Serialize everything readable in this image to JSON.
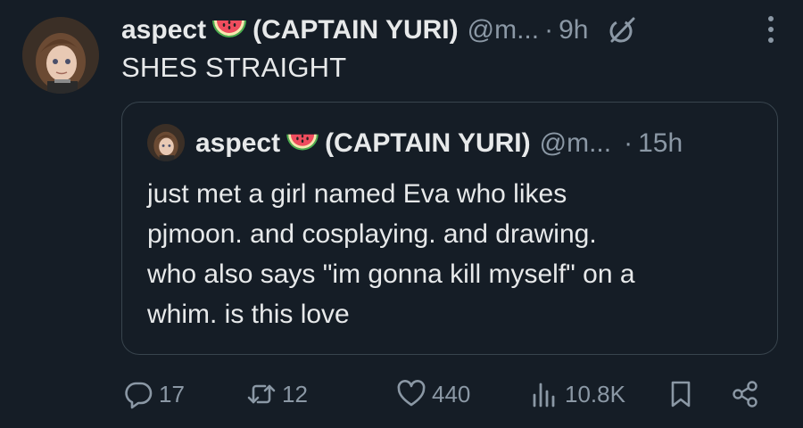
{
  "tweet": {
    "author_name": "aspect",
    "author_name_suffix": "(CAPTAIN YURI)",
    "handle": "@m...",
    "separator": "·",
    "time": "9h",
    "text": "SHES STRAIGHT"
  },
  "quote": {
    "author_name": "aspect",
    "author_name_suffix": "(CAPTAIN YURI)",
    "handle": "@m...",
    "separator": "·",
    "time": "15h",
    "lines": [
      "just met a girl named Eva who likes",
      "pjmoon. and cosplaying. and drawing.",
      "who also says \"im gonna kill myself\" on a",
      "whim. is this love"
    ]
  },
  "actions": {
    "replies": "17",
    "retweets": "12",
    "likes": "440",
    "views": "10.8K"
  },
  "icons": {
    "name_emoji": "watermelon-icon",
    "grok": "grok-icon",
    "more": "more-icon",
    "reply": "reply-icon",
    "retweet": "retweet-icon",
    "like": "heart-icon",
    "views": "views-icon",
    "bookmark": "bookmark-icon",
    "share": "share-icon"
  },
  "colors": {
    "background": "#151d26",
    "text": "#e7e9ea",
    "secondary": "#8b98a5",
    "border": "#38444d"
  }
}
